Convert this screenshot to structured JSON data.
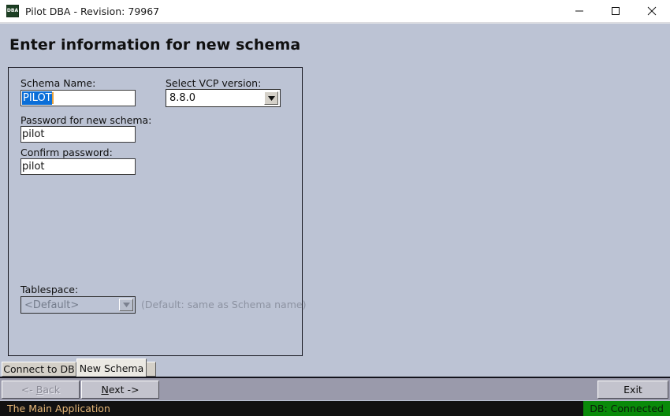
{
  "window": {
    "title": "Pilot DBA - Revision: 79967",
    "icon_label": "DBA",
    "icon_name": "dba-app-icon",
    "minimize_label": "Minimize",
    "maximize_label": "Maximize",
    "close_label": "Close"
  },
  "heading": "Enter information for new schema",
  "form": {
    "schema_name": {
      "label": "Schema Name:",
      "value": "PILOT",
      "selected": true
    },
    "vcp_version": {
      "label": "Select VCP version:",
      "value": "8.8.0"
    },
    "password": {
      "label": "Password for new schema:",
      "value": "pilot"
    },
    "confirm_password": {
      "label": "Confirm password:",
      "value": "pilot"
    },
    "tablespace": {
      "label": "Tablespace:",
      "value": "<Default>",
      "hint": "(Default: same as Schema name)",
      "disabled": true
    }
  },
  "tabs": [
    {
      "label": "Connect to DB",
      "active": false
    },
    {
      "label": "New Schema",
      "active": true
    }
  ],
  "buttons": {
    "back": {
      "label_pre": "<- ",
      "label_accel": "B",
      "label_post": "ack",
      "disabled": true
    },
    "next": {
      "label_pre": "",
      "label_accel": "N",
      "label_post": "ext ->",
      "disabled": false
    },
    "exit": {
      "label": "Exit",
      "disabled": false
    }
  },
  "statusbar": {
    "message": "The Main Application",
    "db_status": "DB: Connected",
    "db_status_color": "#0a8a0a"
  },
  "colors": {
    "window_background": "#bcc3d4",
    "titlebar": "#ffffff",
    "buttonbar": "#9a9aab",
    "tab_inactive": "#d4d0c8",
    "tab_active": "#ebe9e3",
    "selection": "#0a6ed8",
    "caret": "#e8a13a",
    "status_text": "#e8b878",
    "statusbar_background": "#111111"
  }
}
